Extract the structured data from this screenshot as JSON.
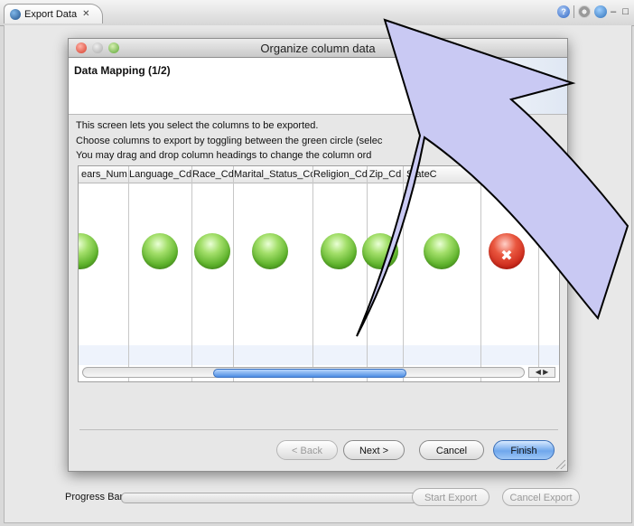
{
  "view": {
    "tab_label": "Export Data",
    "tab_close": "✕",
    "minmax": "– □"
  },
  "bottom": {
    "progress_label": "Progress Bar",
    "progress_value": 0,
    "start_export": "Start Export",
    "cancel_export": "Cancel Export"
  },
  "dialog": {
    "title": "Organize column data",
    "header_title": "Data Mapping (1/2)",
    "description": [
      "This screen lets you select the columns to be exported.",
      "Choose columns to export by toggling between the green circle (selec",
      "You may drag and drop column headings to change the column ord"
    ],
    "columns": [
      {
        "name": "ears_Num",
        "state": "included"
      },
      {
        "name": "Language_Cd",
        "state": "included"
      },
      {
        "name": "Race_Cd",
        "state": "included"
      },
      {
        "name": "Marital_Status_Cd",
        "state": "included"
      },
      {
        "name": "Religion_Cd",
        "state": "included"
      },
      {
        "name": "Zip_Cd",
        "state": "included"
      },
      {
        "name": "StateC",
        "state": "included"
      },
      {
        "name": "",
        "state": "excluded"
      },
      {
        "name": "",
        "state": "none"
      }
    ],
    "buttons": {
      "back": "< Back",
      "next": "Next >",
      "cancel": "Cancel",
      "finish": "Finish"
    }
  },
  "colors": {
    "accent": "#4d8ee3",
    "included": "#5fb32c",
    "excluded": "#c51e12",
    "overlay_arrow": "#c9c9f3"
  }
}
